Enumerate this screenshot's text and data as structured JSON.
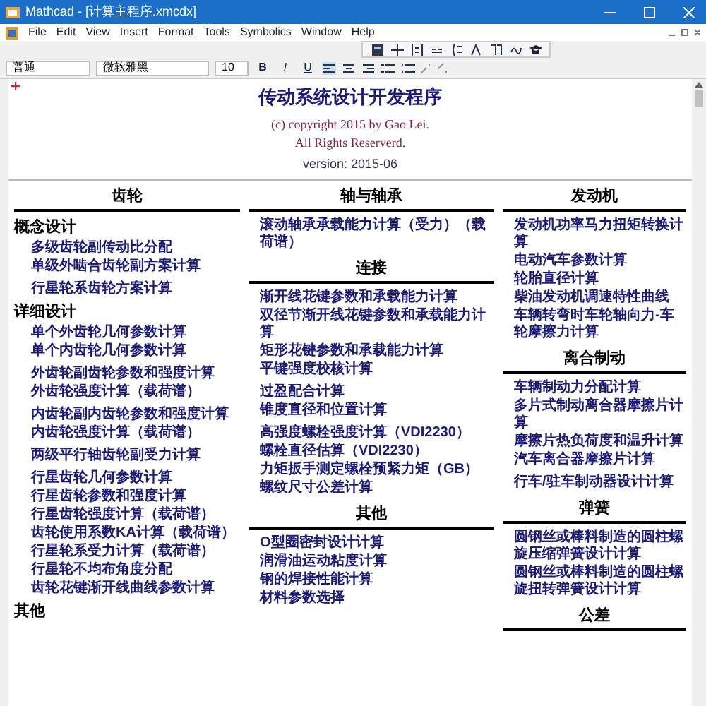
{
  "window": {
    "title": "Mathcad - [计算主程序.xmcdx]"
  },
  "menu": [
    "File",
    "Edit",
    "View",
    "Insert",
    "Format",
    "Tools",
    "Symbolics",
    "Window",
    "Help"
  ],
  "format_toolbar": {
    "style": "普通",
    "font": "微软雅黑",
    "size": "10",
    "buttons": [
      {
        "label": "B",
        "kind": "bold"
      },
      {
        "label": "I",
        "kind": "italic"
      },
      {
        "label": "U",
        "kind": "underline"
      }
    ]
  },
  "document": {
    "title": "传动系统设计开发程序",
    "copyright": [
      "(c) copyright 2015 by Gao Lei.",
      "All Rights Reserverd."
    ],
    "version": "version: 2015-06",
    "columns": [
      {
        "sections": [
          {
            "heading": "齿轮",
            "subsections": [
              {
                "title": "概念设计",
                "groups": [
                  [
                    "多级齿轮副传动比分配",
                    "单级外啮合齿轮副方案计算"
                  ],
                  [
                    "行星轮系齿轮方案计算"
                  ]
                ]
              },
              {
                "title": "详细设计",
                "groups": [
                  [
                    "单个外齿轮几何参数计算",
                    "单个内齿轮几何参数计算"
                  ],
                  [
                    "外齿轮副齿轮参数和强度计算",
                    "外齿轮强度计算（载荷谱）"
                  ],
                  [
                    "内齿轮副内齿轮参数和强度计算",
                    "内齿轮强度计算（载荷谱）"
                  ],
                  [
                    "两级平行轴齿轮副受力计算"
                  ],
                  [
                    "行星齿轮几何参数计算",
                    "行星齿轮参数和强度计算",
                    "行星齿轮强度计算（载荷谱）",
                    "齿轮使用系数KA计算（载荷谱）",
                    "行星轮系受力计算（载荷谱）",
                    "行星轮不均布角度分配",
                    "齿轮花键渐开线曲线参数计算"
                  ]
                ]
              },
              {
                "title": "其他"
              }
            ]
          }
        ]
      },
      {
        "sections": [
          {
            "heading": "轴与轴承",
            "groups": [
              [
                "滚动轴承承载能力计算（受力）（载荷谱）"
              ]
            ]
          },
          {
            "heading": "连接",
            "groups": [
              [
                "渐开线花键参数和承载能力计算",
                "双径节渐开线花键参数和承载能力计算",
                "矩形花键参数和承载能力计算",
                "平键强度校核计算"
              ],
              [
                "过盈配合计算",
                "锥度直径和位置计算"
              ],
              [
                "高强度螺栓强度计算（VDI2230）",
                "螺栓直径估算（VDI2230）",
                "力矩扳手测定螺栓预紧力矩（GB）",
                "螺纹尺寸公差计算"
              ]
            ]
          },
          {
            "heading": "其他",
            "groups": [
              [
                "O型圈密封设计计算",
                "润滑油运动粘度计算",
                "钢的焊接性能计算",
                "材料参数选择"
              ]
            ]
          }
        ]
      },
      {
        "sections": [
          {
            "heading": "发动机",
            "groups": [
              [
                "发动机功率马力扭矩转换计算",
                "电动汽车参数计算",
                "轮胎直径计算",
                "柴油发动机调速特性曲线",
                "车辆转弯时车轮轴向力-车轮摩擦力计算"
              ]
            ]
          },
          {
            "heading": "离合制动",
            "groups": [
              [
                "车辆制动力分配计算",
                "多片式制动离合器摩擦片计算",
                "摩擦片热负荷度和温升计算",
                "汽车离合器摩擦片计算"
              ],
              [
                "行车/驻车制动器设计计算"
              ]
            ]
          },
          {
            "heading": "弹簧",
            "groups": [
              [
                "圆钢丝或棒料制造的圆柱螺旋压缩弹簧设计计算",
                "圆钢丝或棒料制造的圆柱螺旋扭转弹簧设计计算"
              ]
            ]
          },
          {
            "heading": "公差"
          }
        ]
      }
    ]
  }
}
